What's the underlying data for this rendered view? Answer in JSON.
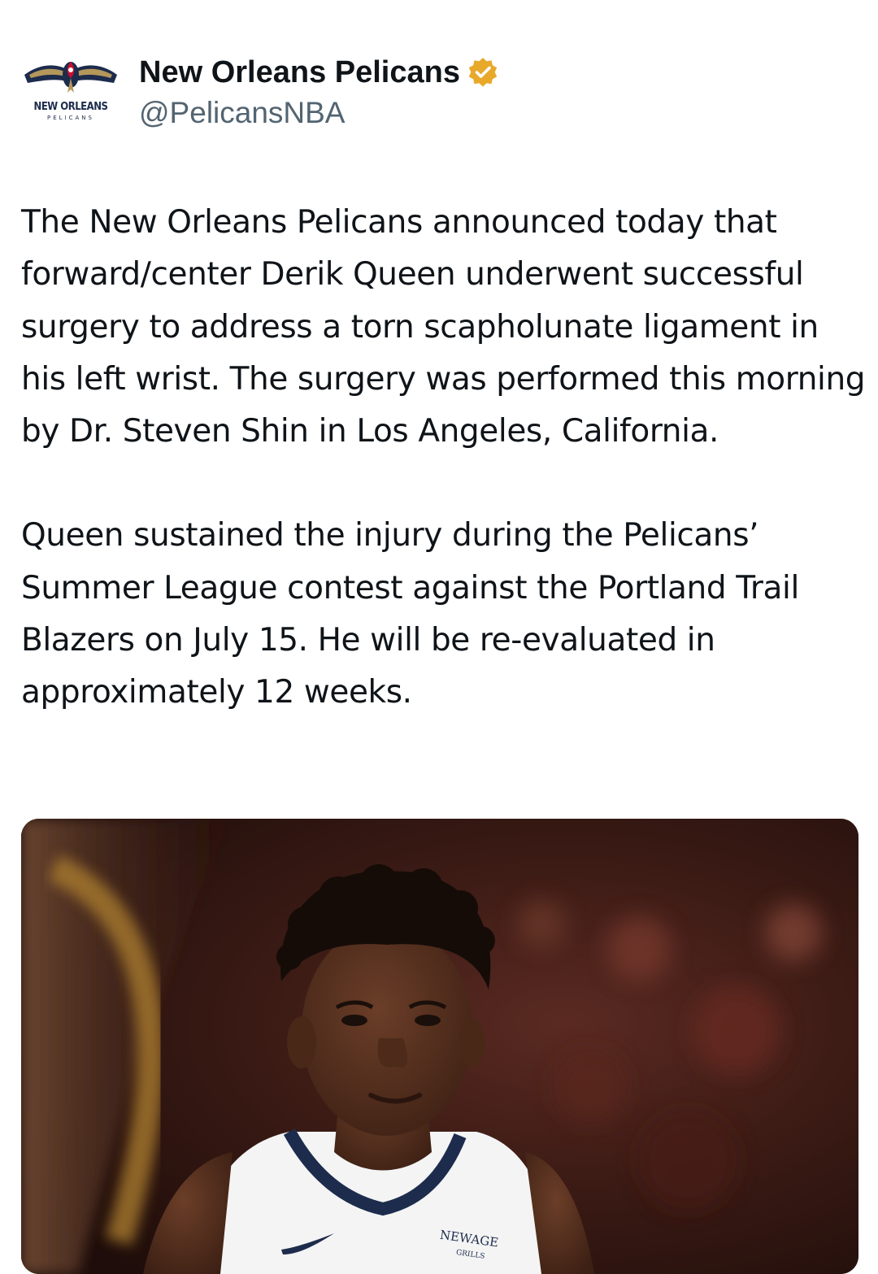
{
  "account": {
    "display_name": "New Orleans Pelicans",
    "handle": "@PelicansNBA",
    "logo_text": "NEW ORLEANS",
    "logo_subtext": "PELICANS",
    "verified_color": "#e8a92b"
  },
  "tweet": {
    "paragraphs": [
      "The New Orleans Pelicans announced today that forward/center Derik Queen underwent successful surgery to address a torn scapholunate ligament in his left wrist. The surgery was performed this morning by Dr. Steven Shin in Los Angeles, California.",
      "Queen sustained the injury during the Pelicans’ Summer League contest against the Portland Trail Blazers on July 15. He will be re-evaluated in approximately 12 weeks."
    ]
  },
  "media": {
    "jersey_sponsor": "NEWAGE",
    "jersey_sponsor_sub": "GRILLS"
  },
  "colors": {
    "text": "#0f1419",
    "secondary_text": "#536471",
    "pelicans_navy": "#1d2c4d",
    "pelicans_gold": "#b4975a"
  }
}
